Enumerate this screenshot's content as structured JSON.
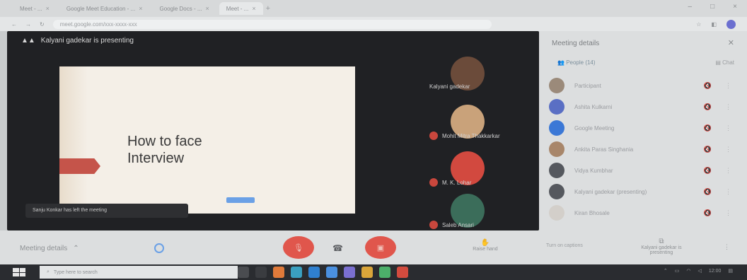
{
  "browser": {
    "tabs": [
      {
        "label": "Meet - ...",
        "active": false
      },
      {
        "label": "Google Meet Education - ...",
        "active": false
      },
      {
        "label": "Google Docs - ...",
        "active": false
      },
      {
        "label": "Meet - ...",
        "active": true
      }
    ],
    "url": "meet.google.com/xxx-xxxx-xxx"
  },
  "stage": {
    "presenting_text": "Kalyani gadekar is presenting",
    "slide_title": "How to face\nInterview",
    "toast": "Sanju Konkar has left the meeting"
  },
  "tiles": [
    {
      "name": "Kalyani gadekar",
      "mic_off": false,
      "color": "#6b4b3a"
    },
    {
      "name": "Mohit Mitra Thakkarkar",
      "mic_off": true,
      "color": "#c9a27a"
    },
    {
      "name": "M. K. Lohar",
      "mic_off": true,
      "color": "#d2493f"
    },
    {
      "name": "Saleb Ansari",
      "mic_off": true,
      "color": "#3b6d5a"
    }
  ],
  "panel": {
    "title": "Meeting details",
    "close_icon": "close-icon",
    "tab_people": "People (14)",
    "tab_chat": "Chat",
    "people": [
      {
        "name": "Participant",
        "color": "#9b8a7a"
      },
      {
        "name": "Ashita Kulkarni",
        "color": "#5a6fc4"
      },
      {
        "name": "Google Meeting",
        "color": "#3b78d6"
      },
      {
        "name": "Ankita Paras Singhania",
        "color": "#a8866a"
      },
      {
        "name": "Vidya Kumbhar",
        "color": "#55585e"
      },
      {
        "name": "Kalyani gadekar (presenting)",
        "color": "#55585e"
      },
      {
        "name": "Kiran Bhosale",
        "color": "#d3cfca"
      }
    ]
  },
  "bottom": {
    "meeting_details": "Meeting details",
    "raise_hand": "Raise hand",
    "turn_captions": "Turn on captions",
    "presenting": "Kalyani gadekar is presenting"
  },
  "taskbar": {
    "search_placeholder": "Type here to search",
    "tray_time": "12:00"
  },
  "colors": {
    "accent_red": "#e0564c",
    "meet_dark": "#202124"
  }
}
